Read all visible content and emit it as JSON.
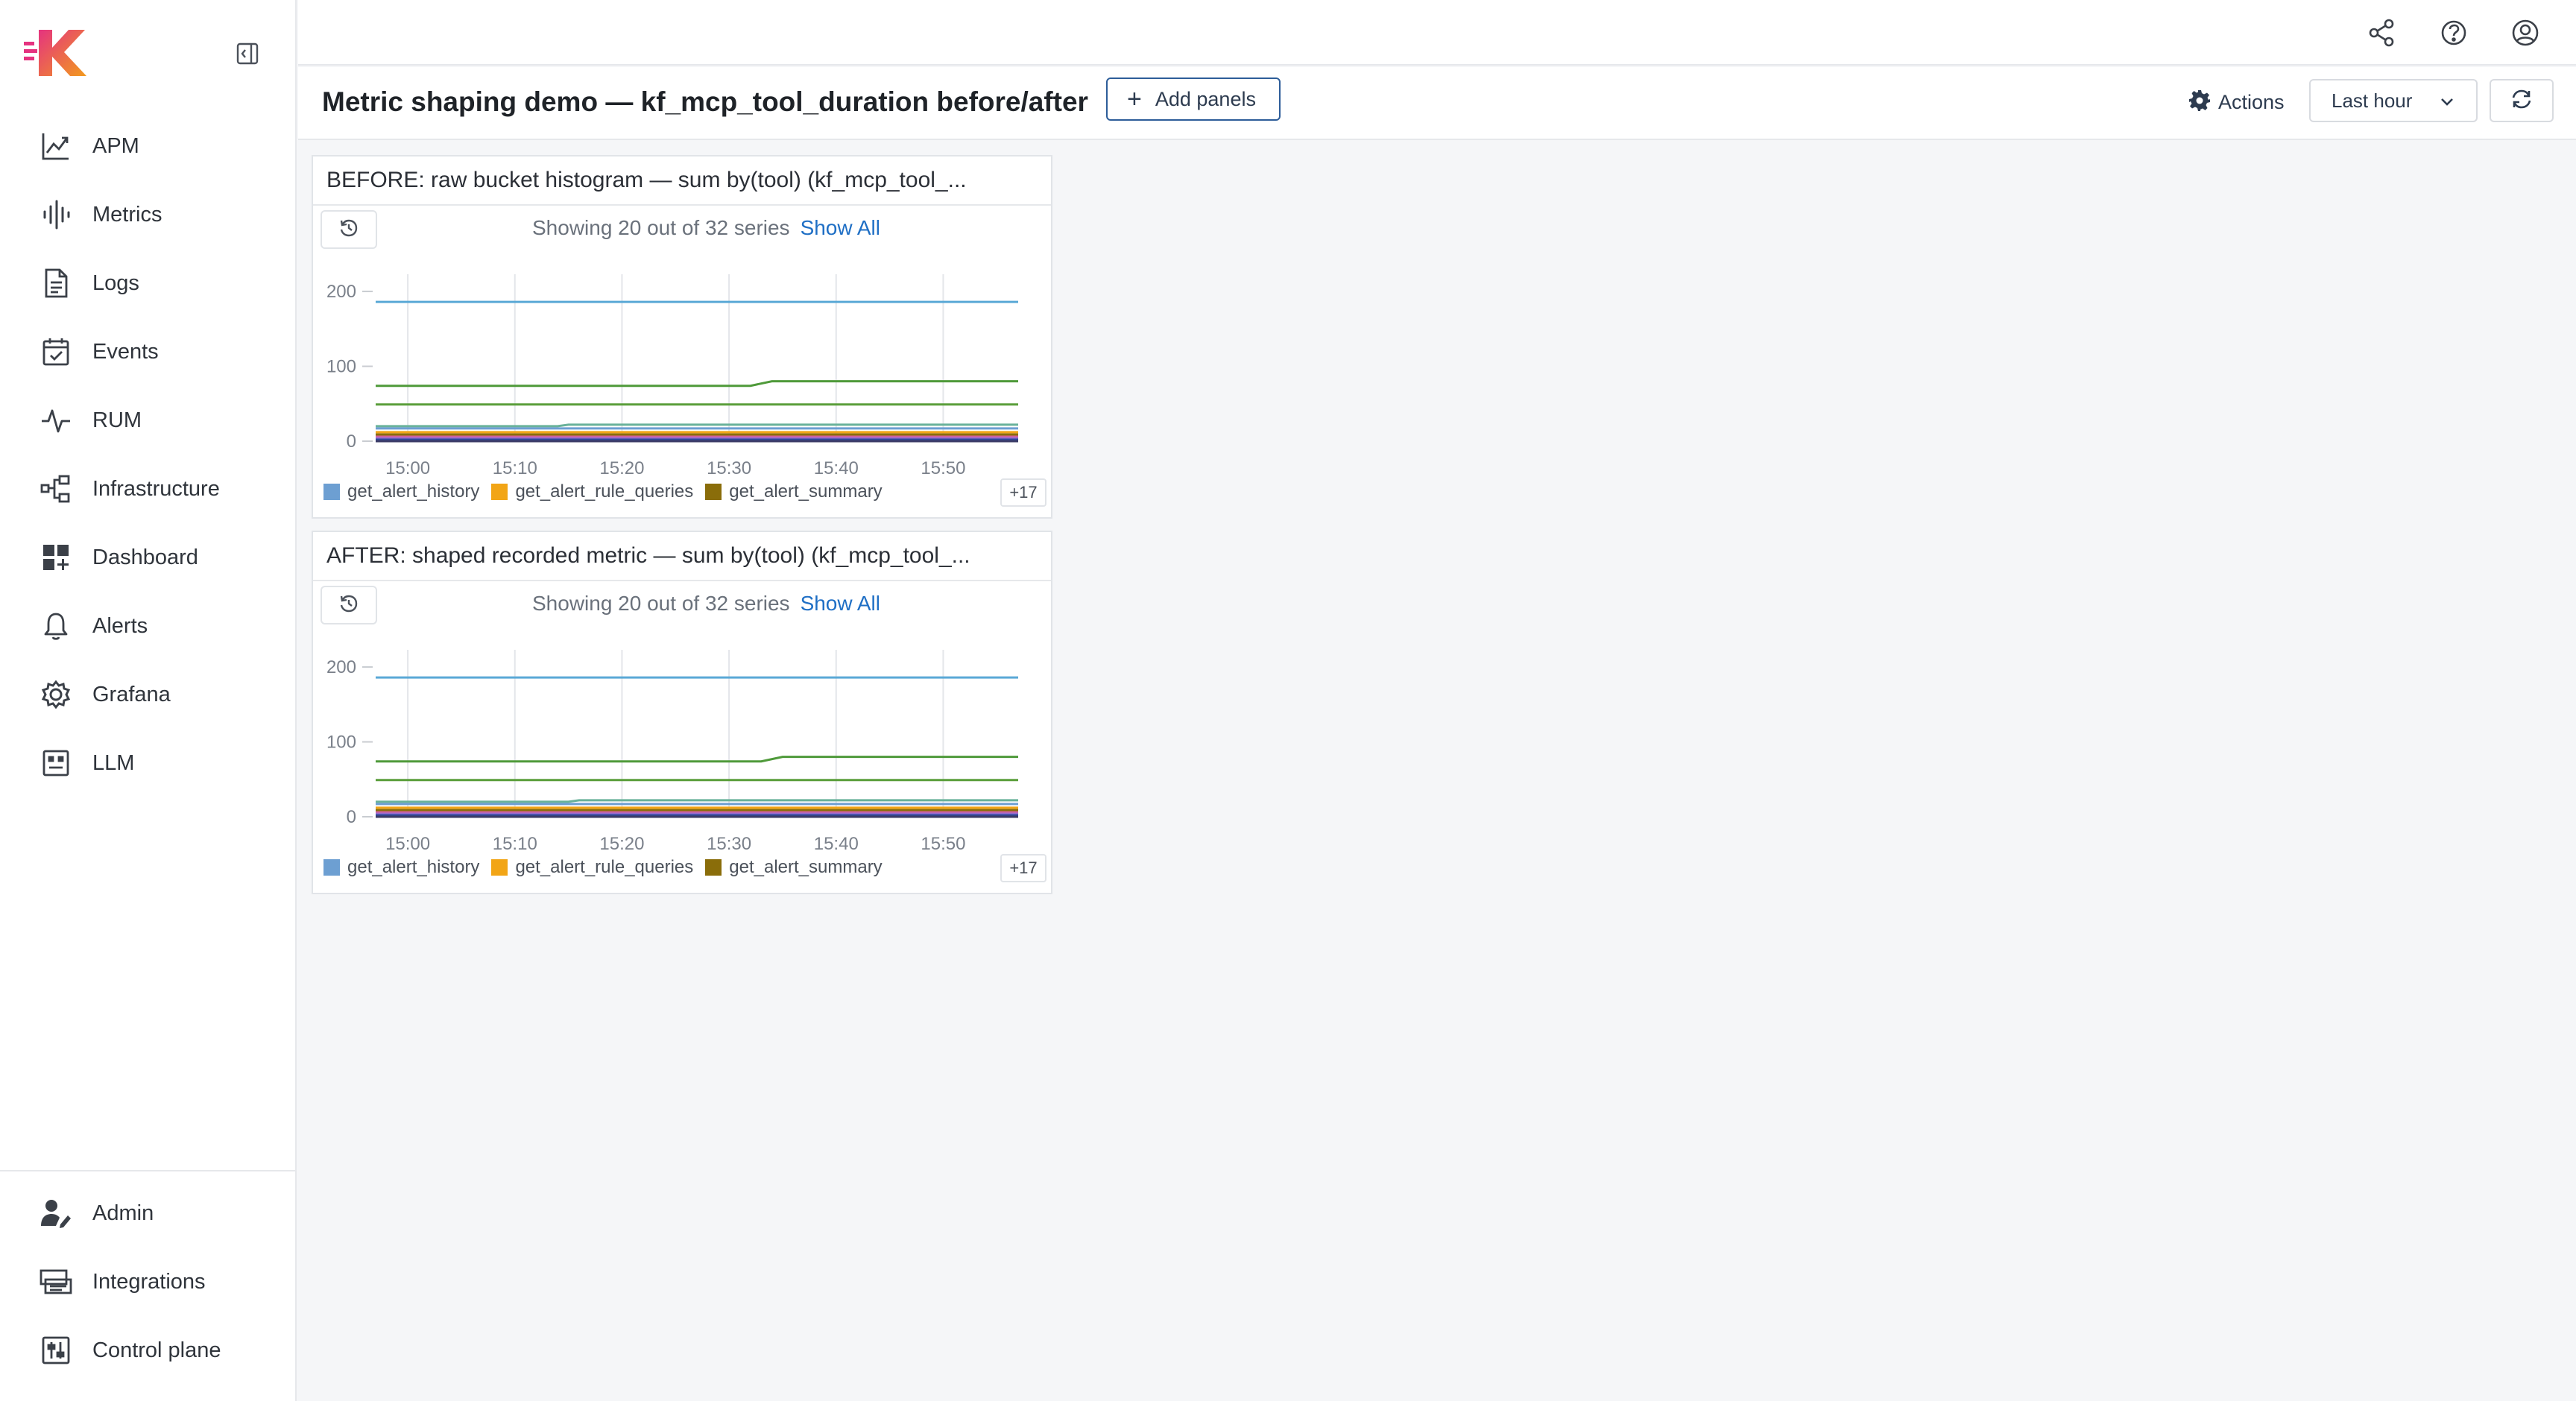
{
  "sidebar": {
    "collapse_icon": "sidebar-collapse-icon",
    "items": [
      {
        "label": "APM",
        "icon": "apm-trend-icon"
      },
      {
        "label": "Metrics",
        "icon": "metrics-waveform-icon"
      },
      {
        "label": "Logs",
        "icon": "logs-document-icon"
      },
      {
        "label": "Events",
        "icon": "events-calendar-icon"
      },
      {
        "label": "RUM",
        "icon": "rum-pulse-icon"
      },
      {
        "label": "Infrastructure",
        "icon": "infrastructure-nodes-icon"
      },
      {
        "label": "Dashboard",
        "icon": "dashboard-grid-icon"
      },
      {
        "label": "Alerts",
        "icon": "alerts-bell-icon"
      },
      {
        "label": "Grafana",
        "icon": "grafana-icon"
      },
      {
        "label": "LLM",
        "icon": "llm-icon"
      }
    ],
    "bottom_items": [
      {
        "label": "Admin",
        "icon": "admin-user-icon"
      },
      {
        "label": "Integrations",
        "icon": "integrations-icon"
      },
      {
        "label": "Control plane",
        "icon": "control-plane-sliders-icon"
      }
    ]
  },
  "topbar": {
    "icons": [
      "share-icon",
      "help-icon",
      "user-account-icon"
    ]
  },
  "header": {
    "title": "Metric shaping demo — kf_mcp_tool_duration before/after",
    "add_panels_label": "Add panels",
    "actions_label": "Actions",
    "time_range": "Last hour"
  },
  "panels": [
    {
      "title": "BEFORE: raw bucket histogram — sum by(tool) (kf_mcp_tool_...",
      "series_info": "Showing 20 out of 32 series",
      "show_all": "Show All",
      "legend": [
        {
          "name": "get_alert_history",
          "color": "#6d9fd2"
        },
        {
          "name": "get_alert_rule_queries",
          "color": "#f2a516"
        },
        {
          "name": "get_alert_summary",
          "color": "#8a6d0a"
        }
      ],
      "more_label": "+17"
    },
    {
      "title": "AFTER: shaped recorded metric — sum by(tool) (kf_mcp_tool_...",
      "series_info": "Showing 20 out of 32 series",
      "show_all": "Show All",
      "legend": [
        {
          "name": "get_alert_history",
          "color": "#6d9fd2"
        },
        {
          "name": "get_alert_rule_queries",
          "color": "#f2a516"
        },
        {
          "name": "get_alert_summary",
          "color": "#8a6d0a"
        }
      ],
      "more_label": "+17"
    }
  ],
  "chart_data": [
    {
      "type": "line",
      "x_ticks": [
        "15:00",
        "15:10",
        "15:20",
        "15:30",
        "15:40",
        "15:50"
      ],
      "y_ticks": [
        0,
        100,
        200
      ],
      "ylim": [
        0,
        215
      ],
      "xlim": [
        "14:57",
        "15:57"
      ],
      "grid": "vertical",
      "series": [
        {
          "color": "#5aa9d6",
          "points": [
            [
              "14:57",
              186
            ],
            [
              "15:57",
              186
            ]
          ]
        },
        {
          "color": "#4f9a3a",
          "points": [
            [
              "14:57",
              74
            ],
            [
              "15:32",
              74
            ],
            [
              "15:34",
              80
            ],
            [
              "15:57",
              80
            ]
          ]
        },
        {
          "color": "#5a9e3a",
          "points": [
            [
              "14:57",
              49
            ],
            [
              "15:57",
              49
            ]
          ]
        },
        {
          "color": "#69b29a",
          "points": [
            [
              "14:57",
              20
            ],
            [
              "15:14",
              20
            ],
            [
              "15:15",
              22
            ],
            [
              "15:57",
              22
            ]
          ]
        },
        {
          "color": "#6d9fd2",
          "points": [
            [
              "14:57",
              17
            ],
            [
              "15:57",
              17
            ]
          ]
        },
        {
          "color": "#f2a516",
          "points": [
            [
              "14:57",
              12
            ],
            [
              "15:57",
              12
            ]
          ]
        },
        {
          "color": "#8a6d0a",
          "points": [
            [
              "14:57",
              9
            ],
            [
              "15:57",
              9
            ]
          ]
        },
        {
          "color": "#d35f9a",
          "points": [
            [
              "14:57",
              6
            ],
            [
              "15:57",
              6
            ]
          ]
        },
        {
          "color": "#9b6ccf",
          "points": [
            [
              "14:57",
              4
            ],
            [
              "15:57",
              4
            ]
          ]
        },
        {
          "color": "#2e4a9e",
          "points": [
            [
              "14:57",
              2
            ],
            [
              "15:57",
              2
            ]
          ]
        },
        {
          "color": "#3b3b66",
          "points": [
            [
              "14:57",
              0
            ],
            [
              "15:57",
              0
            ]
          ]
        }
      ]
    },
    {
      "type": "line",
      "x_ticks": [
        "15:00",
        "15:10",
        "15:20",
        "15:30",
        "15:40",
        "15:50"
      ],
      "y_ticks": [
        0,
        100,
        200
      ],
      "ylim": [
        0,
        215
      ],
      "xlim": [
        "14:57",
        "15:57"
      ],
      "grid": "vertical",
      "series": [
        {
          "color": "#5aa9d6",
          "points": [
            [
              "14:57",
              186
            ],
            [
              "15:57",
              186
            ]
          ]
        },
        {
          "color": "#4f9a3a",
          "points": [
            [
              "14:57",
              74
            ],
            [
              "15:33",
              74
            ],
            [
              "15:35",
              80
            ],
            [
              "15:57",
              80
            ]
          ]
        },
        {
          "color": "#5a9e3a",
          "points": [
            [
              "14:57",
              49
            ],
            [
              "15:57",
              49
            ]
          ]
        },
        {
          "color": "#69b29a",
          "points": [
            [
              "14:57",
              20
            ],
            [
              "15:15",
              20
            ],
            [
              "15:16",
              22
            ],
            [
              "15:57",
              22
            ]
          ]
        },
        {
          "color": "#6d9fd2",
          "points": [
            [
              "14:57",
              17
            ],
            [
              "15:57",
              17
            ]
          ]
        },
        {
          "color": "#f2a516",
          "points": [
            [
              "14:57",
              12
            ],
            [
              "15:57",
              12
            ]
          ]
        },
        {
          "color": "#8a6d0a",
          "points": [
            [
              "14:57",
              9
            ],
            [
              "15:57",
              9
            ]
          ]
        },
        {
          "color": "#d35f9a",
          "points": [
            [
              "14:57",
              6
            ],
            [
              "15:57",
              6
            ]
          ]
        },
        {
          "color": "#9b6ccf",
          "points": [
            [
              "14:57",
              4
            ],
            [
              "15:57",
              4
            ]
          ]
        },
        {
          "color": "#2e4a9e",
          "points": [
            [
              "14:57",
              2
            ],
            [
              "15:57",
              2
            ]
          ]
        },
        {
          "color": "#3b3b66",
          "points": [
            [
              "14:57",
              0
            ],
            [
              "15:57",
              0
            ]
          ]
        }
      ]
    }
  ]
}
